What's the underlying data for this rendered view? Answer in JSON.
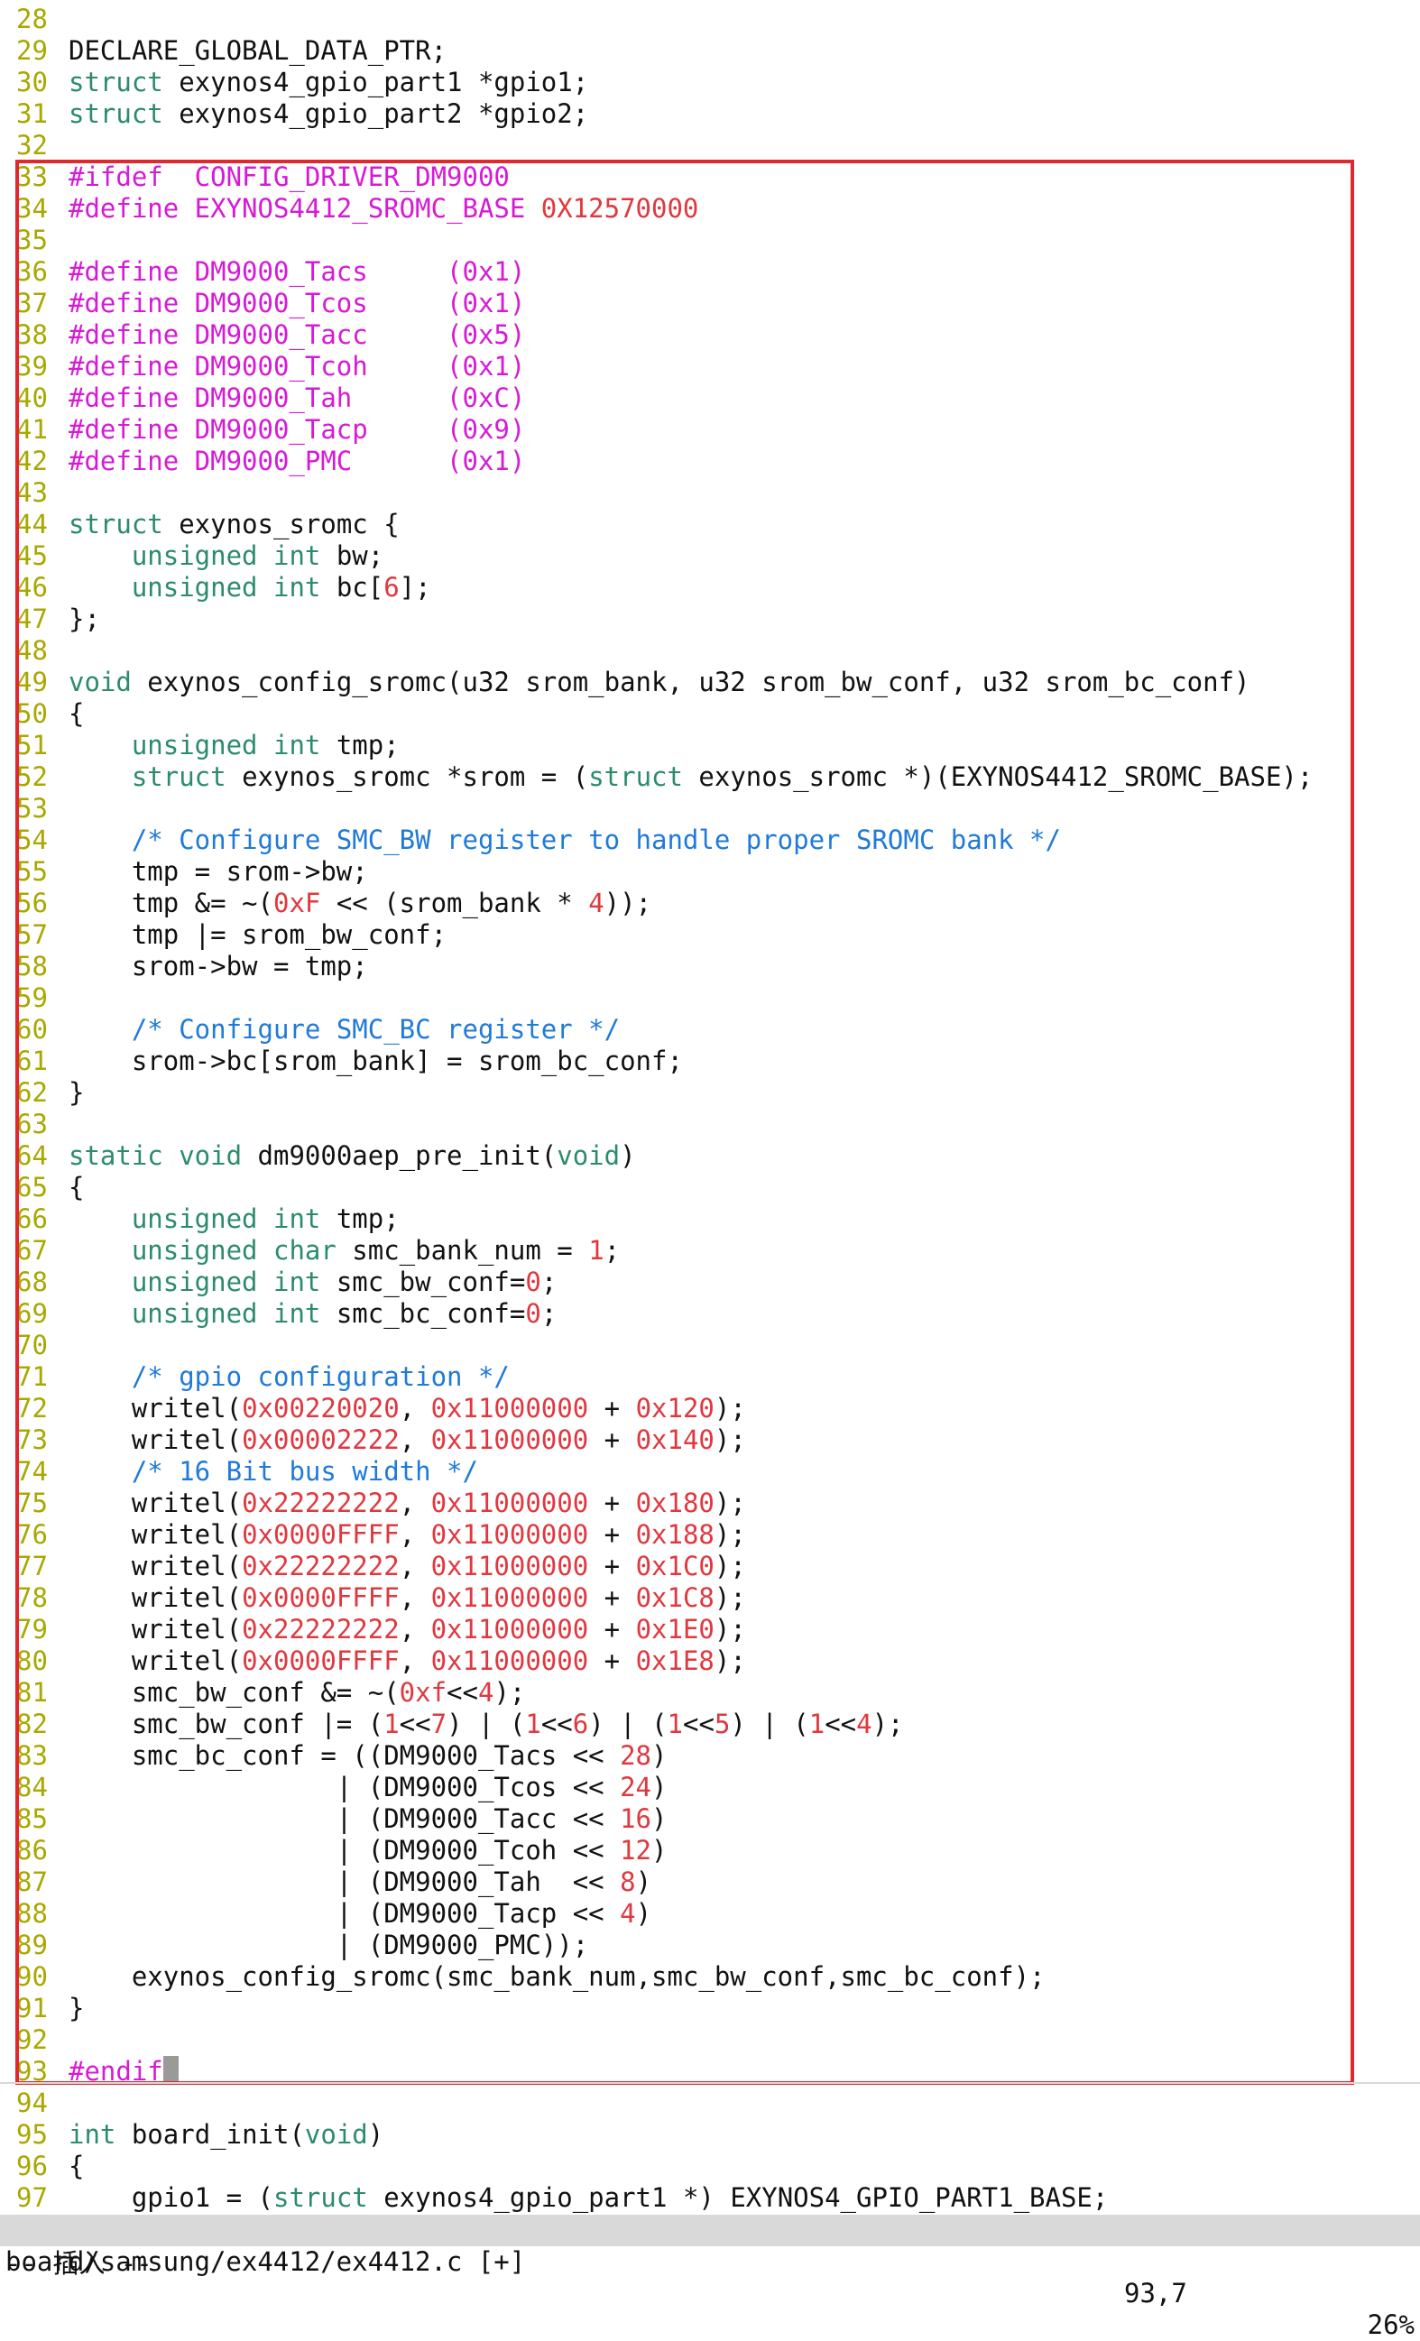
{
  "editor": {
    "lines": [
      {
        "n": "28",
        "segs": []
      },
      {
        "n": "29",
        "segs": [
          [
            "t",
            "DECLARE_GLOBAL_DATA_PTR;"
          ]
        ]
      },
      {
        "n": "30",
        "segs": [
          [
            "kw",
            "struct"
          ],
          [
            "t",
            " exynos4_gpio_part1 *gpio1;"
          ]
        ]
      },
      {
        "n": "31",
        "segs": [
          [
            "kw",
            "struct"
          ],
          [
            "t",
            " exynos4_gpio_part2 *gpio2;"
          ]
        ]
      },
      {
        "n": "32",
        "segs": []
      },
      {
        "n": "33",
        "segs": [
          [
            "pp",
            "#ifdef  CONFIG_DRIVER_DM9000"
          ]
        ]
      },
      {
        "n": "34",
        "segs": [
          [
            "pp",
            "#define EXYNOS4412_SROMC_BASE "
          ],
          [
            "num",
            "0X12570000"
          ]
        ]
      },
      {
        "n": "35",
        "segs": []
      },
      {
        "n": "36",
        "segs": [
          [
            "pp",
            "#define DM9000_Tacs     (0x1)"
          ]
        ]
      },
      {
        "n": "37",
        "segs": [
          [
            "pp",
            "#define DM9000_Tcos     (0x1)"
          ]
        ]
      },
      {
        "n": "38",
        "segs": [
          [
            "pp",
            "#define DM9000_Tacc     (0x5)"
          ]
        ]
      },
      {
        "n": "39",
        "segs": [
          [
            "pp",
            "#define DM9000_Tcoh     (0x1)"
          ]
        ]
      },
      {
        "n": "40",
        "segs": [
          [
            "pp",
            "#define DM9000_Tah      (0xC)"
          ]
        ]
      },
      {
        "n": "41",
        "segs": [
          [
            "pp",
            "#define DM9000_Tacp     (0x9)"
          ]
        ]
      },
      {
        "n": "42",
        "segs": [
          [
            "pp",
            "#define DM9000_PMC      (0x1)"
          ]
        ]
      },
      {
        "n": "43",
        "segs": []
      },
      {
        "n": "44",
        "segs": [
          [
            "kw",
            "struct"
          ],
          [
            "t",
            " exynos_sromc {"
          ]
        ]
      },
      {
        "n": "45",
        "segs": [
          [
            "t",
            "    "
          ],
          [
            "kw",
            "unsigned int"
          ],
          [
            "t",
            " bw;"
          ]
        ]
      },
      {
        "n": "46",
        "segs": [
          [
            "t",
            "    "
          ],
          [
            "kw",
            "unsigned int"
          ],
          [
            "t",
            " bc["
          ],
          [
            "num",
            "6"
          ],
          [
            "t",
            "];"
          ]
        ]
      },
      {
        "n": "47",
        "segs": [
          [
            "t",
            "};"
          ]
        ]
      },
      {
        "n": "48",
        "segs": []
      },
      {
        "n": "49",
        "segs": [
          [
            "kw",
            "void"
          ],
          [
            "t",
            " exynos_config_sromc(u32 srom_bank, u32 srom_bw_conf, u32 srom_bc_conf)"
          ]
        ]
      },
      {
        "n": "50",
        "segs": [
          [
            "t",
            "{"
          ]
        ]
      },
      {
        "n": "51",
        "segs": [
          [
            "t",
            "    "
          ],
          [
            "kw",
            "unsigned int"
          ],
          [
            "t",
            " tmp;"
          ]
        ]
      },
      {
        "n": "52",
        "segs": [
          [
            "t",
            "    "
          ],
          [
            "kw",
            "struct"
          ],
          [
            "t",
            " exynos_sromc *srom = ("
          ],
          [
            "kw",
            "struct"
          ],
          [
            "t",
            " exynos_sromc *)(EXYNOS4412_SROMC_BASE);"
          ]
        ]
      },
      {
        "n": "53",
        "segs": []
      },
      {
        "n": "54",
        "segs": [
          [
            "t",
            "    "
          ],
          [
            "cm",
            "/* Configure SMC_BW register to handle proper SROMC bank */"
          ]
        ]
      },
      {
        "n": "55",
        "segs": [
          [
            "t",
            "    tmp = srom->bw;"
          ]
        ]
      },
      {
        "n": "56",
        "segs": [
          [
            "t",
            "    tmp &= ~("
          ],
          [
            "num",
            "0xF"
          ],
          [
            "t",
            " << (srom_bank * "
          ],
          [
            "num",
            "4"
          ],
          [
            "t",
            "));"
          ]
        ]
      },
      {
        "n": "57",
        "segs": [
          [
            "t",
            "    tmp |= srom_bw_conf;"
          ]
        ]
      },
      {
        "n": "58",
        "segs": [
          [
            "t",
            "    srom->bw = tmp;"
          ]
        ]
      },
      {
        "n": "59",
        "segs": []
      },
      {
        "n": "60",
        "segs": [
          [
            "t",
            "    "
          ],
          [
            "cm",
            "/* Configure SMC_BC register */"
          ]
        ]
      },
      {
        "n": "61",
        "segs": [
          [
            "t",
            "    srom->bc[srom_bank] = srom_bc_conf;"
          ]
        ]
      },
      {
        "n": "62",
        "segs": [
          [
            "t",
            "}"
          ]
        ]
      },
      {
        "n": "63",
        "segs": []
      },
      {
        "n": "64",
        "segs": [
          [
            "kw",
            "static void"
          ],
          [
            "t",
            " dm9000aep_pre_init("
          ],
          [
            "kw",
            "void"
          ],
          [
            "t",
            ")"
          ]
        ]
      },
      {
        "n": "65",
        "segs": [
          [
            "t",
            "{"
          ]
        ]
      },
      {
        "n": "66",
        "segs": [
          [
            "t",
            "    "
          ],
          [
            "kw",
            "unsigned int"
          ],
          [
            "t",
            " tmp;"
          ]
        ]
      },
      {
        "n": "67",
        "segs": [
          [
            "t",
            "    "
          ],
          [
            "kw",
            "unsigned char"
          ],
          [
            "t",
            " smc_bank_num = "
          ],
          [
            "num",
            "1"
          ],
          [
            "t",
            ";"
          ]
        ]
      },
      {
        "n": "68",
        "segs": [
          [
            "t",
            "    "
          ],
          [
            "kw",
            "unsigned int"
          ],
          [
            "t",
            " smc_bw_conf="
          ],
          [
            "num",
            "0"
          ],
          [
            "t",
            ";"
          ]
        ]
      },
      {
        "n": "69",
        "segs": [
          [
            "t",
            "    "
          ],
          [
            "kw",
            "unsigned int"
          ],
          [
            "t",
            " smc_bc_conf="
          ],
          [
            "num",
            "0"
          ],
          [
            "t",
            ";"
          ]
        ]
      },
      {
        "n": "70",
        "segs": []
      },
      {
        "n": "71",
        "segs": [
          [
            "t",
            "    "
          ],
          [
            "cm",
            "/* gpio configuration */"
          ]
        ]
      },
      {
        "n": "72",
        "segs": [
          [
            "t",
            "    writel("
          ],
          [
            "num",
            "0x00220020"
          ],
          [
            "t",
            ", "
          ],
          [
            "num",
            "0x11000000"
          ],
          [
            "t",
            " + "
          ],
          [
            "num",
            "0x120"
          ],
          [
            "t",
            ");"
          ]
        ]
      },
      {
        "n": "73",
        "segs": [
          [
            "t",
            "    writel("
          ],
          [
            "num",
            "0x00002222"
          ],
          [
            "t",
            ", "
          ],
          [
            "num",
            "0x11000000"
          ],
          [
            "t",
            " + "
          ],
          [
            "num",
            "0x140"
          ],
          [
            "t",
            ");"
          ]
        ]
      },
      {
        "n": "74",
        "segs": [
          [
            "t",
            "    "
          ],
          [
            "cm",
            "/* 16 Bit bus width */"
          ]
        ]
      },
      {
        "n": "75",
        "segs": [
          [
            "t",
            "    writel("
          ],
          [
            "num",
            "0x22222222"
          ],
          [
            "t",
            ", "
          ],
          [
            "num",
            "0x11000000"
          ],
          [
            "t",
            " + "
          ],
          [
            "num",
            "0x180"
          ],
          [
            "t",
            ");"
          ]
        ]
      },
      {
        "n": "76",
        "segs": [
          [
            "t",
            "    writel("
          ],
          [
            "num",
            "0x0000FFFF"
          ],
          [
            "t",
            ", "
          ],
          [
            "num",
            "0x11000000"
          ],
          [
            "t",
            " + "
          ],
          [
            "num",
            "0x188"
          ],
          [
            "t",
            ");"
          ]
        ]
      },
      {
        "n": "77",
        "segs": [
          [
            "t",
            "    writel("
          ],
          [
            "num",
            "0x22222222"
          ],
          [
            "t",
            ", "
          ],
          [
            "num",
            "0x11000000"
          ],
          [
            "t",
            " + "
          ],
          [
            "num",
            "0x1C0"
          ],
          [
            "t",
            ");"
          ]
        ]
      },
      {
        "n": "78",
        "segs": [
          [
            "t",
            "    writel("
          ],
          [
            "num",
            "0x0000FFFF"
          ],
          [
            "t",
            ", "
          ],
          [
            "num",
            "0x11000000"
          ],
          [
            "t",
            " + "
          ],
          [
            "num",
            "0x1C8"
          ],
          [
            "t",
            ");"
          ]
        ]
      },
      {
        "n": "79",
        "segs": [
          [
            "t",
            "    writel("
          ],
          [
            "num",
            "0x22222222"
          ],
          [
            "t",
            ", "
          ],
          [
            "num",
            "0x11000000"
          ],
          [
            "t",
            " + "
          ],
          [
            "num",
            "0x1E0"
          ],
          [
            "t",
            ");"
          ]
        ]
      },
      {
        "n": "80",
        "segs": [
          [
            "t",
            "    writel("
          ],
          [
            "num",
            "0x0000FFFF"
          ],
          [
            "t",
            ", "
          ],
          [
            "num",
            "0x11000000"
          ],
          [
            "t",
            " + "
          ],
          [
            "num",
            "0x1E8"
          ],
          [
            "t",
            ");"
          ]
        ]
      },
      {
        "n": "81",
        "segs": [
          [
            "t",
            "    smc_bw_conf &= ~("
          ],
          [
            "num",
            "0xf"
          ],
          [
            "t",
            "<<"
          ],
          [
            "num",
            "4"
          ],
          [
            "t",
            ");"
          ]
        ]
      },
      {
        "n": "82",
        "segs": [
          [
            "t",
            "    smc_bw_conf |= ("
          ],
          [
            "num",
            "1"
          ],
          [
            "t",
            "<<"
          ],
          [
            "num",
            "7"
          ],
          [
            "t",
            ") | ("
          ],
          [
            "num",
            "1"
          ],
          [
            "t",
            "<<"
          ],
          [
            "num",
            "6"
          ],
          [
            "t",
            ") | ("
          ],
          [
            "num",
            "1"
          ],
          [
            "t",
            "<<"
          ],
          [
            "num",
            "5"
          ],
          [
            "t",
            ") | ("
          ],
          [
            "num",
            "1"
          ],
          [
            "t",
            "<<"
          ],
          [
            "num",
            "4"
          ],
          [
            "t",
            ");"
          ]
        ]
      },
      {
        "n": "83",
        "segs": [
          [
            "t",
            "    smc_bc_conf = ((DM9000_Tacs << "
          ],
          [
            "num",
            "28"
          ],
          [
            "t",
            ")"
          ]
        ]
      },
      {
        "n": "84",
        "segs": [
          [
            "t",
            "                 | (DM9000_Tcos << "
          ],
          [
            "num",
            "24"
          ],
          [
            "t",
            ")"
          ]
        ]
      },
      {
        "n": "85",
        "segs": [
          [
            "t",
            "                 | (DM9000_Tacc << "
          ],
          [
            "num",
            "16"
          ],
          [
            "t",
            ")"
          ]
        ]
      },
      {
        "n": "86",
        "segs": [
          [
            "t",
            "                 | (DM9000_Tcoh << "
          ],
          [
            "num",
            "12"
          ],
          [
            "t",
            ")"
          ]
        ]
      },
      {
        "n": "87",
        "segs": [
          [
            "t",
            "                 | (DM9000_Tah  << "
          ],
          [
            "num",
            "8"
          ],
          [
            "t",
            ")"
          ]
        ]
      },
      {
        "n": "88",
        "segs": [
          [
            "t",
            "                 | (DM9000_Tacp << "
          ],
          [
            "num",
            "4"
          ],
          [
            "t",
            ")"
          ]
        ]
      },
      {
        "n": "89",
        "segs": [
          [
            "t",
            "                 | (DM9000_PMC));"
          ]
        ]
      },
      {
        "n": "90",
        "segs": [
          [
            "t",
            "    exynos_config_sromc(smc_bank_num,smc_bw_conf,smc_bc_conf);"
          ]
        ]
      },
      {
        "n": "91",
        "segs": [
          [
            "t",
            "}"
          ]
        ]
      },
      {
        "n": "92",
        "segs": []
      },
      {
        "n": "93",
        "segs": [
          [
            "pp",
            "#endif"
          ],
          [
            "cursor",
            ""
          ]
        ]
      },
      {
        "n": "94",
        "segs": []
      },
      {
        "n": "95",
        "segs": [
          [
            "kw",
            "int"
          ],
          [
            "t",
            " board_init("
          ],
          [
            "kw",
            "void"
          ],
          [
            "t",
            ")"
          ]
        ]
      },
      {
        "n": "96",
        "segs": [
          [
            "t",
            "{"
          ]
        ]
      },
      {
        "n": "97",
        "segs": [
          [
            "t",
            "    gpio1 = ("
          ],
          [
            "kw",
            "struct"
          ],
          [
            "t",
            " exynos4_gpio_part1 *) EXYNOS4_GPIO_PART1_BASE;"
          ]
        ]
      }
    ]
  },
  "status": {
    "file": "board/samsung/ex4412/ex4412.c [+]",
    "position": "93,7",
    "percent": "26%"
  },
  "mode": "-- 插入 --",
  "colors": {
    "keyword": "#2c8c6a",
    "preprocessor": "#d61ad6",
    "number": "#e0383e",
    "comment": "#1f7ad8",
    "line_number": "#a8a800",
    "highlight_box": "#e0282e"
  }
}
